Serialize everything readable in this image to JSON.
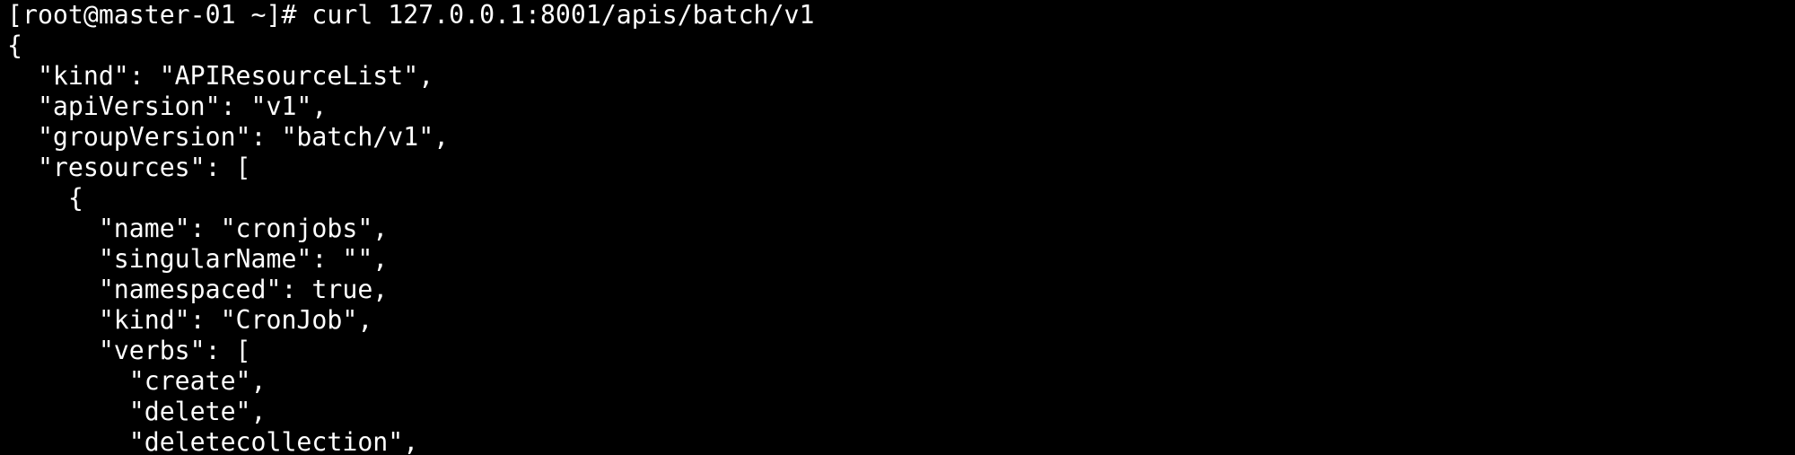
{
  "terminal": {
    "background": "#000000",
    "foreground": "#ffffff",
    "prompt": "[root@master-01 ~]# ",
    "command": "curl 127.0.0.1:8001/apis/batch/v1",
    "output": [
      "{",
      "  \"kind\": \"APIResourceList\",",
      "  \"apiVersion\": \"v1\",",
      "  \"groupVersion\": \"batch/v1\",",
      "  \"resources\": [",
      "    {",
      "      \"name\": \"cronjobs\",",
      "      \"singularName\": \"\",",
      "      \"namespaced\": true,",
      "      \"kind\": \"CronJob\",",
      "      \"verbs\": [",
      "        \"create\",",
      "        \"delete\",",
      "        \"deletecollection\","
    ]
  }
}
